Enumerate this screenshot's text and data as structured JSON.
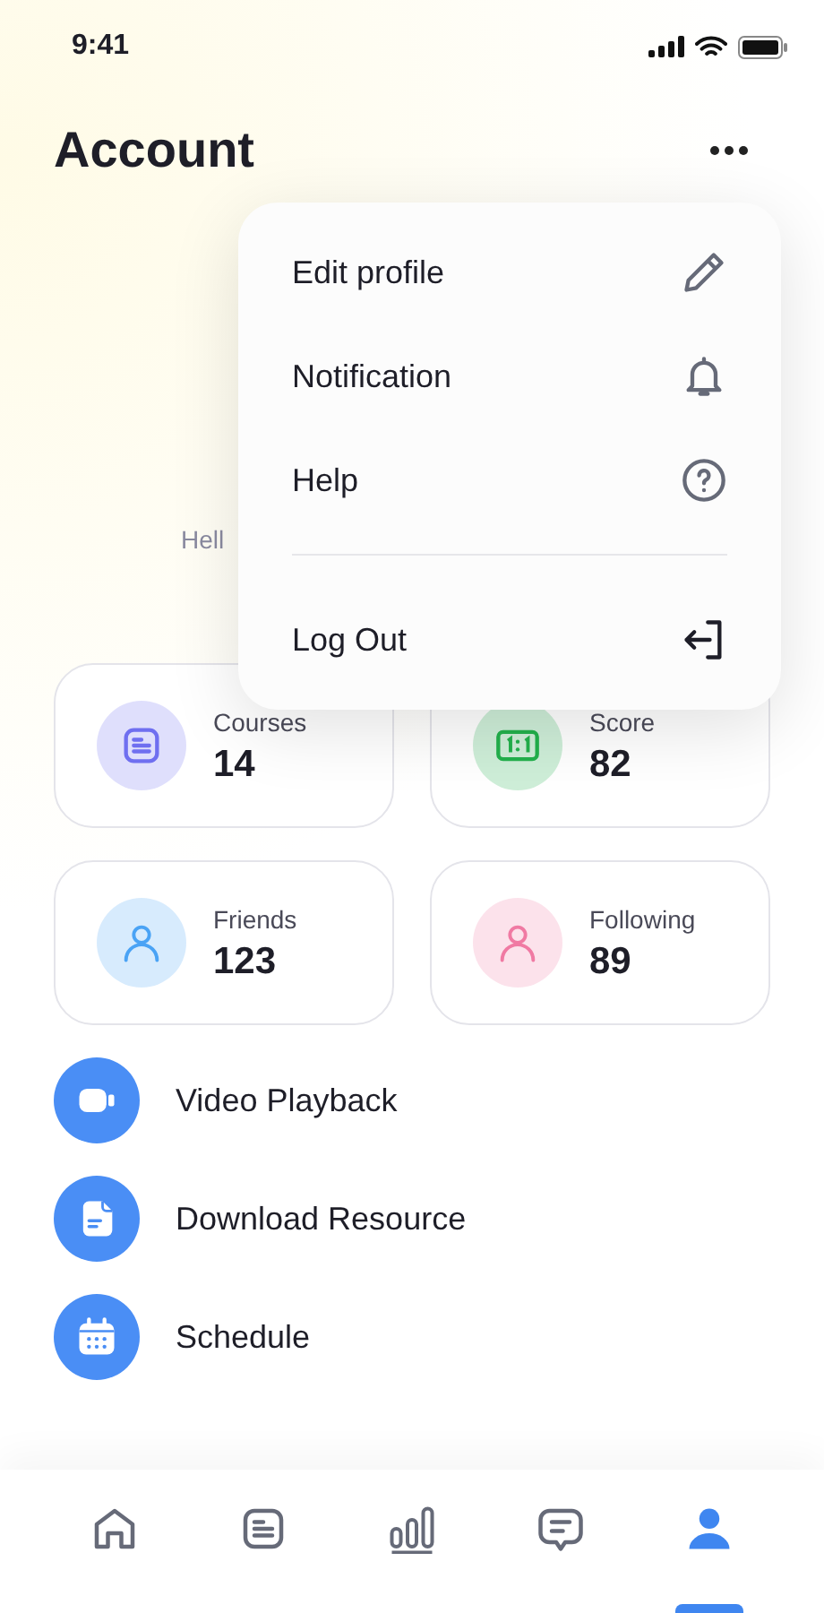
{
  "status_bar": {
    "time": "9:41"
  },
  "header": {
    "title": "Account"
  },
  "greeting": "Hell",
  "menu": {
    "items": [
      {
        "label": "Edit profile"
      },
      {
        "label": "Notification"
      },
      {
        "label": "Help"
      }
    ],
    "footer_items": [
      {
        "label": "Log Out"
      }
    ]
  },
  "stats": [
    {
      "label": "Courses",
      "value": "14",
      "color": "#6f6ff0"
    },
    {
      "label": "Score",
      "value": "82",
      "color": "#22b14c"
    },
    {
      "label": "Friends",
      "value": "123",
      "color": "#4aa3f5"
    },
    {
      "label": "Following",
      "value": "89",
      "color": "#f07aa3"
    }
  ],
  "links": [
    {
      "label": "Video Playback"
    },
    {
      "label": "Download Resource"
    },
    {
      "label": "Schedule"
    }
  ],
  "tab_bar": [
    {
      "selected": false
    },
    {
      "selected": false
    },
    {
      "selected": false
    },
    {
      "selected": false
    },
    {
      "selected": true
    }
  ]
}
